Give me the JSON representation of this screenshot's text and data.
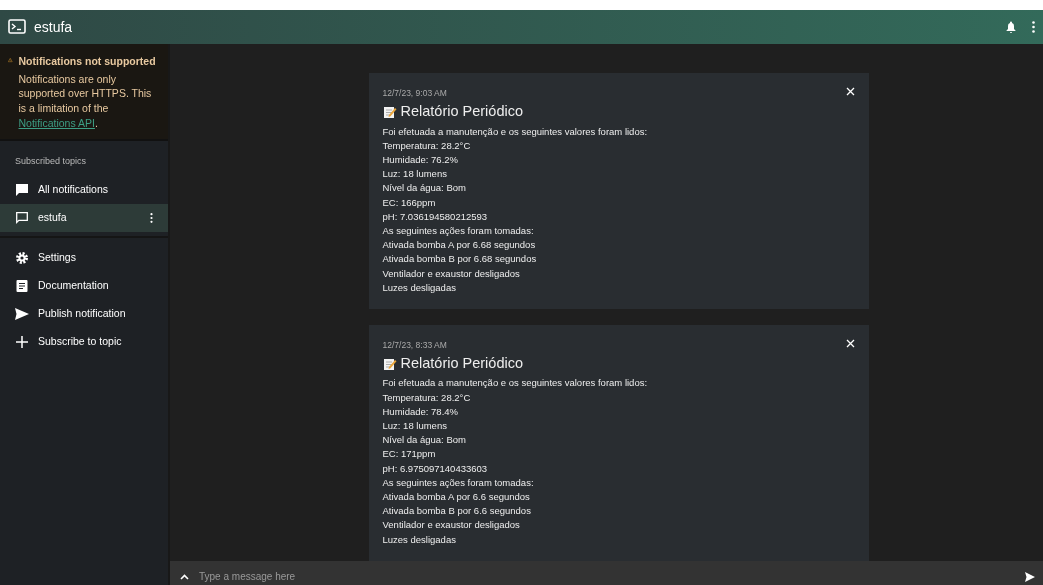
{
  "app_bar": {
    "title": "estufa"
  },
  "warning": {
    "title": "Notifications not supported",
    "text": "Notifications are only supported over HTTPS. This is a limitation of the ",
    "link": "Notifications API",
    "after": "."
  },
  "sidebar": {
    "section_label": "Subscribed topics",
    "topics": [
      {
        "label": "All notifications",
        "kind": "all",
        "selected": false,
        "has_menu": false
      },
      {
        "label": "estufa",
        "kind": "topic",
        "selected": true,
        "has_menu": true
      }
    ],
    "items": [
      {
        "label": "Settings"
      },
      {
        "label": "Documentation"
      },
      {
        "label": "Publish notification"
      },
      {
        "label": "Subscribe to topic"
      }
    ]
  },
  "notifications": [
    {
      "time": "12/7/23, 9:03 AM",
      "title": "Relatório Periódico",
      "lines": [
        "Foi efetuada a manutenção e os seguintes valores foram lidos:",
        "Temperatura: 28.2°C",
        "Humidade: 76.2%",
        "Luz: 18 lumens",
        "Nível da água: Bom",
        "EC: 166ppm",
        "pH: 7.036194580212593",
        "As seguintes ações foram tomadas:",
        "Ativada bomba A por 6.68 segundos",
        "Ativada bomba B por 6.68 segundos",
        "Ventilador e exaustor desligados",
        "Luzes desligadas"
      ]
    },
    {
      "time": "12/7/23, 8:33 AM",
      "title": "Relatório Periódico",
      "lines": [
        "Foi efetuada a manutenção e os seguintes valores foram lidos:",
        "Temperatura: 28.2°C",
        "Humidade: 78.4%",
        "Luz: 18 lumens",
        "Nível da água: Bom",
        "EC: 171ppm",
        "pH: 6.975097140433603",
        "As seguintes ações foram tomadas:",
        "Ativada bomba A por 6.6 segundos",
        "Ativada bomba B por 6.6 segundos",
        "Ventilador e exaustor desligados",
        "Luzes desligadas"
      ]
    }
  ],
  "composer": {
    "placeholder": "Type a message here"
  }
}
